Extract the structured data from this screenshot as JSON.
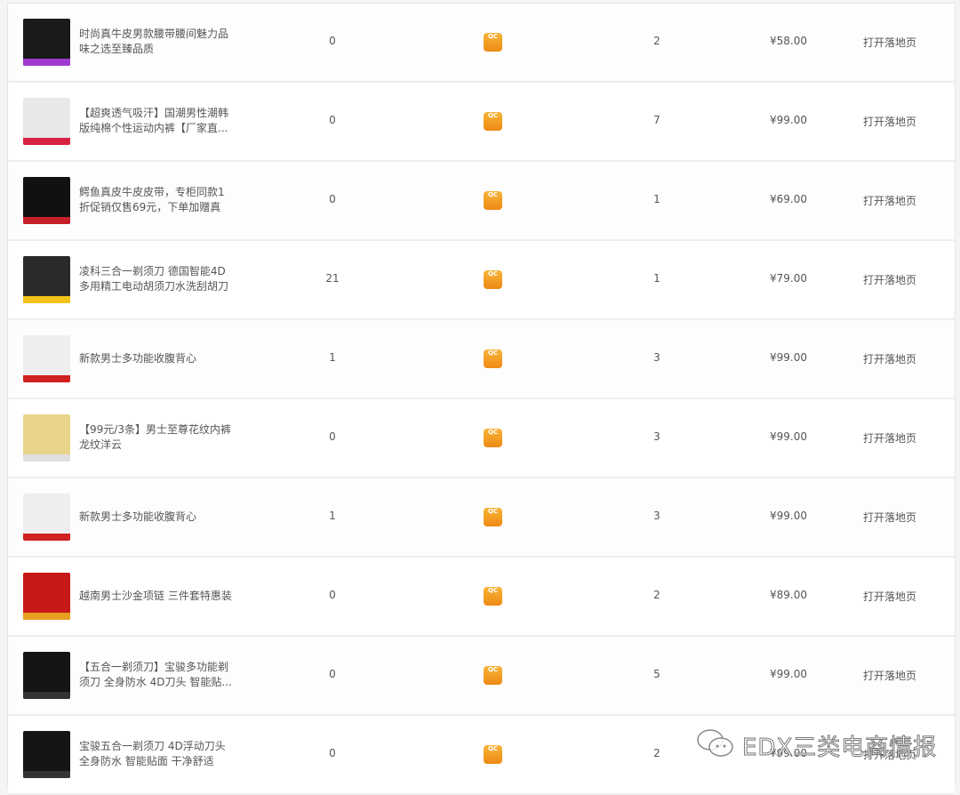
{
  "rows": [
    {
      "title": "时尚真牛皮男款腰带腰间魅力品味之选至臻品质",
      "count": "0",
      "num": "2",
      "price": "¥58.00",
      "link": "打开落地页",
      "thumb": "#1a1a1a",
      "band": "#a03ad0"
    },
    {
      "title": "【超爽透气吸汗】国潮男性潮韩版纯棉个性运动内裤【厂家直...",
      "count": "0",
      "num": "7",
      "price": "¥99.00",
      "link": "打开落地页",
      "thumb": "#e8e8e8",
      "band": "#d82040"
    },
    {
      "title": "鳄鱼真皮牛皮皮带，专柜同款1折促销仅售69元，下单加赠真皮...",
      "count": "0",
      "num": "1",
      "price": "¥69.00",
      "link": "打开落地页",
      "thumb": "#111111",
      "band": "#c8202a"
    },
    {
      "title": "凌科三合一剃须刀 德国智能4D多用精工电动胡须刀水洗刮胡刀",
      "count": "21",
      "num": "1",
      "price": "¥79.00",
      "link": "打开落地页",
      "thumb": "#2a2a2a",
      "band": "#f2c21a"
    },
    {
      "title": "新款男士多功能收腹背心",
      "count": "1",
      "num": "3",
      "price": "¥99.00",
      "link": "打开落地页",
      "thumb": "#eeeeee",
      "band": "#d02020"
    },
    {
      "title": "【99元/3条】男士至尊花纹内裤龙纹洋云",
      "count": "0",
      "num": "3",
      "price": "¥99.00",
      "link": "打开落地页",
      "thumb": "#e8d48a",
      "band": "#e0e0e0"
    },
    {
      "title": "新款男士多功能收腹背心",
      "count": "1",
      "num": "3",
      "price": "¥99.00",
      "link": "打开落地页",
      "thumb": "#eeeeee",
      "band": "#d02020"
    },
    {
      "title": "越南男士沙金项链 三件套特惠装",
      "count": "0",
      "num": "2",
      "price": "¥89.00",
      "link": "打开落地页",
      "thumb": "#c81818",
      "band": "#e8a020"
    },
    {
      "title": "【五合一剃须刀】宝骏多功能剃须刀 全身防水 4D刀头 智能贴...",
      "count": "0",
      "num": "5",
      "price": "¥99.00",
      "link": "打开落地页",
      "thumb": "#151515",
      "band": "#333333"
    },
    {
      "title": "宝骏五合一剃须刀 4D浮动刀头全身防水 智能贴面 干净舒适",
      "count": "0",
      "num": "2",
      "price": "¥99.00",
      "link": "打开落地页",
      "thumb": "#151515",
      "band": "#333333"
    }
  ],
  "app_icon_text": "QC",
  "watermark": "EDX三类电商情报"
}
